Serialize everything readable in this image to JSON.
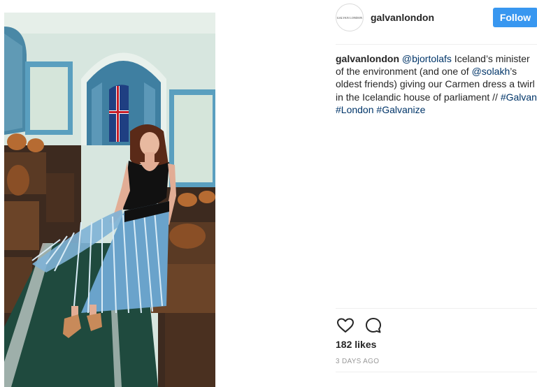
{
  "post": {
    "avatar_text": "GALVAN LONDON",
    "username": "galvanlondon",
    "follow_label": "Follow",
    "caption": {
      "author": "galvanlondon",
      "mention1": "@bjortolafs",
      "text1": " Iceland’s minister of the environment (and one of ",
      "mention2": "@solakh",
      "text2": "’s oldest friends) giving our Carmen dress a twirl in the Icelandic house of parliament // ",
      "tag1": "#Galvan",
      "tag2": "#London",
      "tag3": "#Galvanize"
    },
    "actions": {
      "like_icon": "heart-icon",
      "comment_icon": "comment-icon"
    },
    "likes": "182 likes",
    "date": "3 DAYS AGO"
  },
  "colors": {
    "follow": "#3897f0",
    "link": "#003569",
    "meta": "#999999"
  }
}
